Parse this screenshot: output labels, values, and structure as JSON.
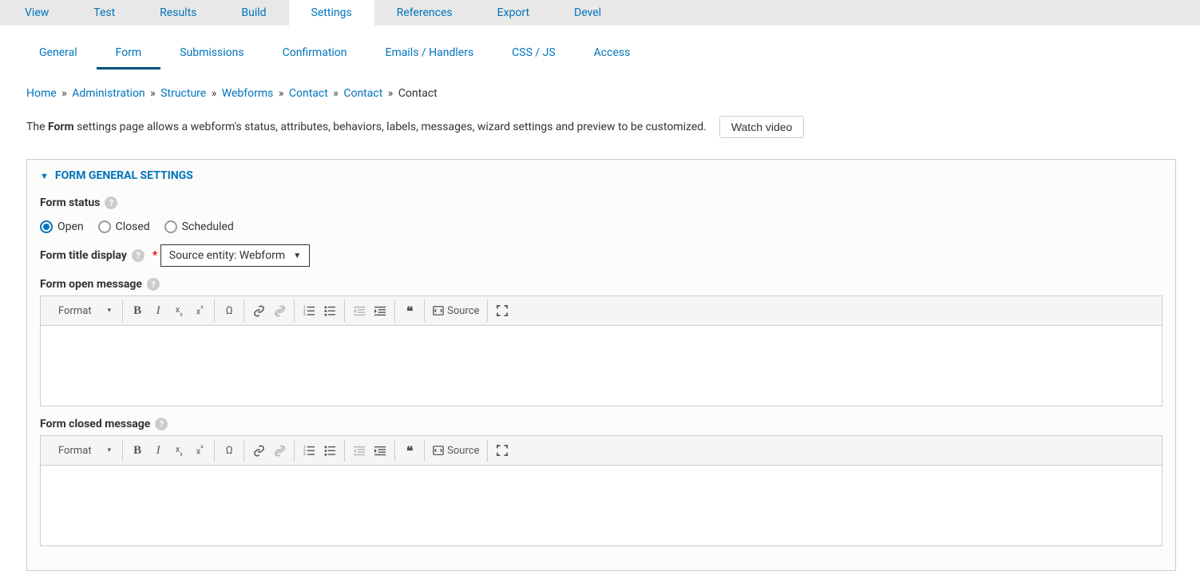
{
  "primary_tabs": {
    "items": [
      {
        "label": "View"
      },
      {
        "label": "Test"
      },
      {
        "label": "Results"
      },
      {
        "label": "Build"
      },
      {
        "label": "Settings",
        "active": true
      },
      {
        "label": "References"
      },
      {
        "label": "Export"
      },
      {
        "label": "Devel"
      }
    ]
  },
  "secondary_tabs": {
    "items": [
      {
        "label": "General"
      },
      {
        "label": "Form",
        "active": true
      },
      {
        "label": "Submissions"
      },
      {
        "label": "Confirmation"
      },
      {
        "label": "Emails / Handlers"
      },
      {
        "label": "CSS / JS"
      },
      {
        "label": "Access"
      }
    ]
  },
  "breadcrumb": {
    "items": [
      {
        "label": "Home",
        "link": true
      },
      {
        "label": "Administration",
        "link": true
      },
      {
        "label": "Structure",
        "link": true
      },
      {
        "label": "Webforms",
        "link": true
      },
      {
        "label": "Contact",
        "link": true
      },
      {
        "label": "Contact",
        "link": true
      },
      {
        "label": "Contact",
        "link": false
      }
    ],
    "sep": "»"
  },
  "description": {
    "prefix": "The ",
    "bold": "Form",
    "suffix": " settings page allows a webform's status, attributes, behaviors, labels, messages, wizard settings and preview to be customized."
  },
  "watch_video": "Watch video",
  "fieldset": {
    "title": "FORM GENERAL SETTINGS"
  },
  "form_status": {
    "label": "Form status",
    "options": [
      {
        "label": "Open",
        "checked": true
      },
      {
        "label": "Closed",
        "checked": false
      },
      {
        "label": "Scheduled",
        "checked": false
      }
    ]
  },
  "form_title_display": {
    "label": "Form title display",
    "value": "Source entity: Webform"
  },
  "form_open_message": {
    "label": "Form open message"
  },
  "form_closed_message": {
    "label": "Form closed message"
  },
  "editor": {
    "format": "Format",
    "source": "Source"
  },
  "help": "?"
}
